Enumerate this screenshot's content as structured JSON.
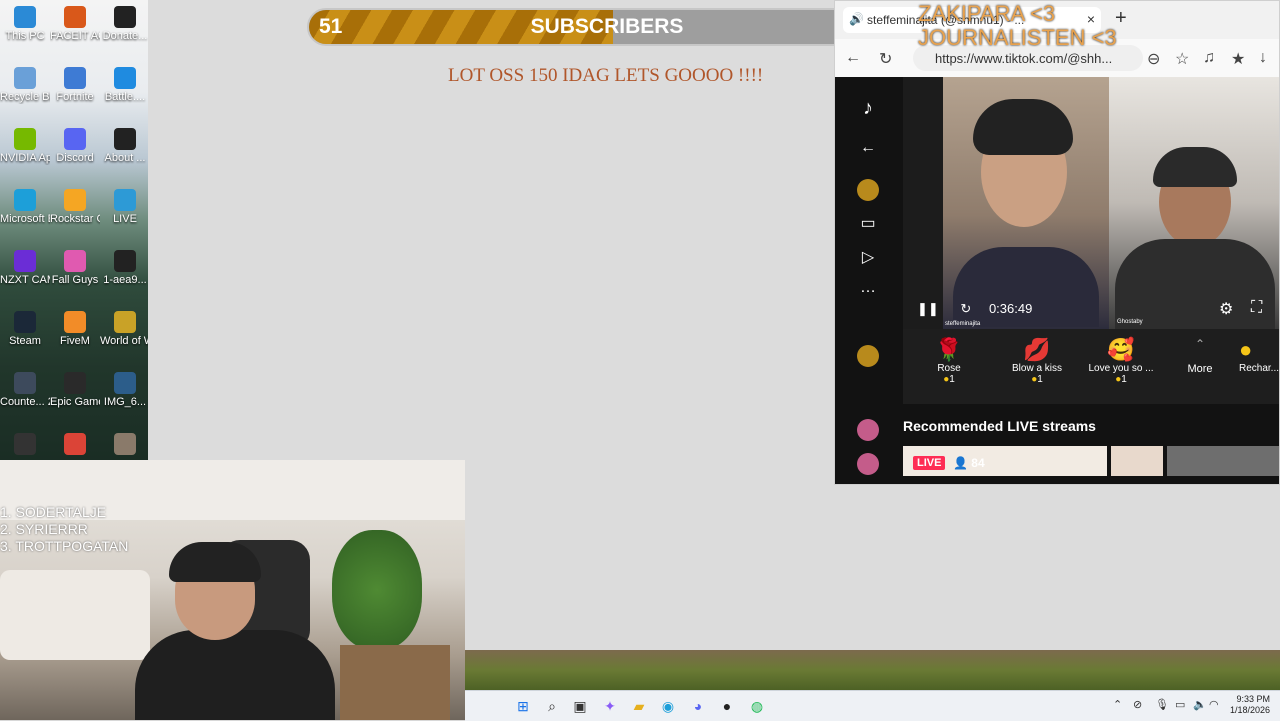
{
  "desktop_icons": [
    {
      "label": "This PC",
      "color": "#2b8ad6"
    },
    {
      "label": "FACEIT AC",
      "color": "#d9581a"
    },
    {
      "label": "Donate...",
      "color": "#222222"
    },
    {
      "label": "Recycle Bin",
      "color": "#6aa0d8"
    },
    {
      "label": "Fortnite",
      "color": "#3e7bd4"
    },
    {
      "label": "Battle....",
      "color": "#1f8be0"
    },
    {
      "label": "NVIDIA App",
      "color": "#76b900"
    },
    {
      "label": "Discord",
      "color": "#5865f2"
    },
    {
      "label": "About ...",
      "color": "#222222"
    },
    {
      "label": "Microsoft Edge",
      "color": "#1d9fd9"
    },
    {
      "label": "Rockstar Games ...",
      "color": "#f5a623"
    },
    {
      "label": "LIVE",
      "color": "#2d9ad6"
    },
    {
      "label": "NZXT CAM",
      "color": "#6b2dd6"
    },
    {
      "label": "Fall Guys",
      "color": "#e05ab0"
    },
    {
      "label": "1-aea9...",
      "color": "#222222"
    },
    {
      "label": "Steam",
      "color": "#1b2838"
    },
    {
      "label": "FiveM",
      "color": "#f28c28"
    },
    {
      "label": "World of Warcraft",
      "color": "#c9a227"
    },
    {
      "label": "Counte... 2",
      "color": "#3d4a5c"
    },
    {
      "label": "Epic Games ...",
      "color": "#2a2a2a"
    },
    {
      "label": "IMG_6...",
      "color": "#2c5d8a"
    },
    {
      "label": "",
      "color": "#333333"
    },
    {
      "label": "",
      "color": "#db4437"
    },
    {
      "label": "",
      "color": "#8a7a6a"
    }
  ],
  "subscriber_goal": {
    "current": "51",
    "title": "SUBSCRIBERS",
    "target": "100",
    "progress": 0.51,
    "message": "LOT OSS 150 IDAG LETS GOOOO !!!!"
  },
  "overlay_title": {
    "line1": "ZAKIPARA <3",
    "line2": "JOURNALISTEN <3"
  },
  "browser": {
    "tab_title": "steffeminajita (@shmnu1) - ...",
    "url": "https://www.tiktok.com/@shh...",
    "new_tab": "+",
    "close": "×"
  },
  "tiktok": {
    "timer": "0:36:49",
    "streamer_left": "steffeminajita",
    "streamer_right": "Ghostaby",
    "gifts": [
      {
        "name": "Rose",
        "price": "1",
        "icon": "🌹"
      },
      {
        "name": "Blow a kiss",
        "price": "1",
        "icon": "💋"
      },
      {
        "name": "Love you so ...",
        "price": "1",
        "icon": "🥰"
      }
    ],
    "more_label": "More",
    "recharge_label": "Rechar...",
    "recommended_heading": "Recommended LIVE streams",
    "live_badge": "LIVE",
    "viewer_count": "84",
    "accent": "#fe2c55"
  },
  "ranking": [
    "1. SODERTALJE",
    "2. SYRIERRR",
    "3. TROTTPOGATAN"
  ],
  "taskbar": {
    "time": "9:33 PM",
    "date": "1/18/2026",
    "apps": [
      "windows-start",
      "search",
      "task-view",
      "copilot",
      "file-explorer",
      "edge",
      "discord",
      "obs",
      "spotify"
    ]
  }
}
